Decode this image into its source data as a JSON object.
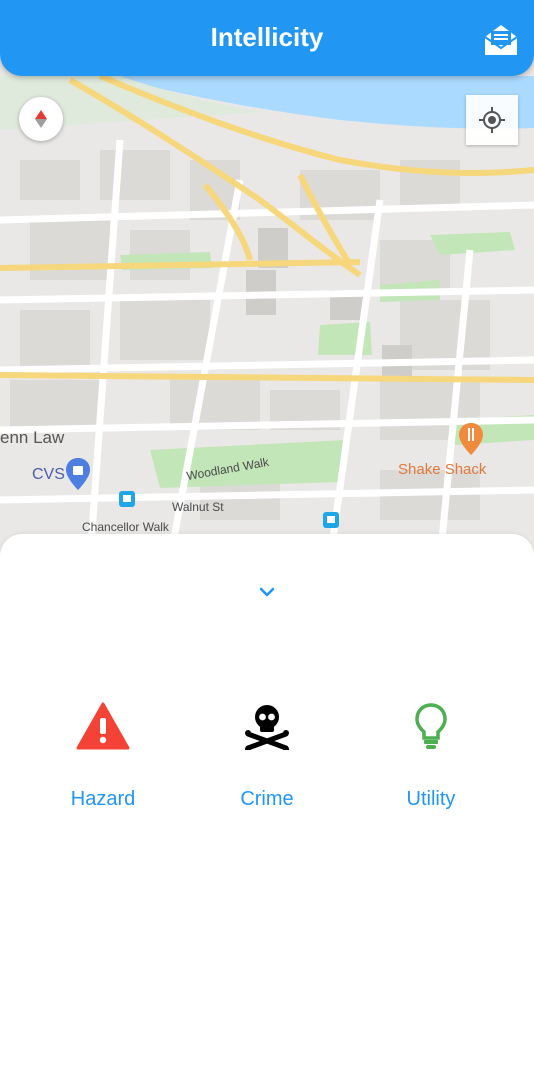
{
  "app_bar": {
    "title": "Intellicity",
    "mail_icon": "mail-open-icon",
    "color": "#2196f3"
  },
  "map": {
    "compass_icon": "compass-icon",
    "locate_icon": "my-location-icon",
    "labels": {
      "place_penn_law": "enn Law",
      "cvs": "CVS",
      "shake_shack": "Shake Shack",
      "woodland_walk": "Woodland Walk",
      "walnut_st": "Walnut St",
      "chancellor_walk": "Chancellor Walk"
    }
  },
  "sheet": {
    "collapse_icon": "chevron-down-icon",
    "categories": [
      {
        "label": "Hazard",
        "icon": "warning-icon",
        "color": "#f44336"
      },
      {
        "label": "Crime",
        "icon": "skull-crossbones-icon",
        "color": "#000000"
      },
      {
        "label": "Utility",
        "icon": "lightbulb-icon",
        "color": "#4caf50"
      }
    ],
    "label_color": "#2196f3"
  }
}
